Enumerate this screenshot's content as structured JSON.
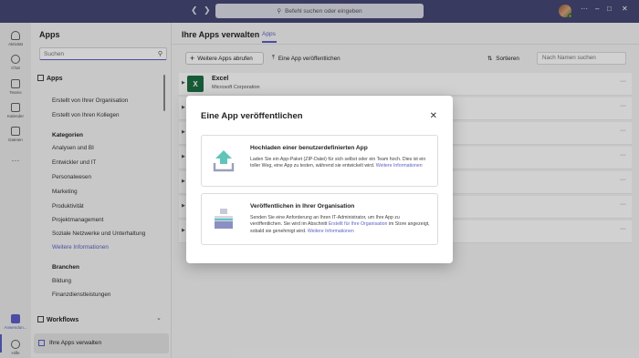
{
  "titlebar": {
    "search_placeholder": "Befehl suchen oder eingeben",
    "back_icon": "chevron-left-icon",
    "forward_icon": "chevron-right-icon"
  },
  "window_controls": {
    "more": "···",
    "minimize": "–",
    "maximize": "□",
    "close": "✕"
  },
  "rail": {
    "items": [
      {
        "label": "Aktivität",
        "icon": "bell-icon"
      },
      {
        "label": "Chat",
        "icon": "chat-icon"
      },
      {
        "label": "Teams",
        "icon": "teams-icon"
      },
      {
        "label": "Kalender",
        "icon": "calendar-icon"
      },
      {
        "label": "Dateien",
        "icon": "file-icon"
      },
      {
        "label": "···",
        "icon": "more-icon"
      },
      {
        "label": "Anwendun...",
        "icon": "apps-icon"
      },
      {
        "label": "Hilfe",
        "icon": "help-icon"
      }
    ]
  },
  "sidebar": {
    "title": "Apps",
    "search_placeholder": "Suchen",
    "section_apps": "Apps",
    "apps_links": [
      "Erstellt von Ihrer Organisation",
      "Erstellt von Ihren Kollegen"
    ],
    "categories_heading": "Kategorien",
    "categories": [
      "Analysen und BI",
      "Entwickler und IT",
      "Personalwesen",
      "Marketing",
      "Produktivität",
      "Projektmanagement",
      "Soziale Netzwerke und Unterhaltung",
      "Weitere Informationen"
    ],
    "branchen_heading": "Branchen",
    "branchen": [
      "Bildung",
      "Finanzdienstleistungen"
    ],
    "workflows": "Workflows",
    "manage_apps": "Ihre Apps verwalten"
  },
  "main": {
    "title": "Ihre Apps verwalten",
    "tab": "Apps",
    "get_more": "Weitere Apps abrufen",
    "publish": "Eine App veröffentlichen",
    "sort": "Sortieren",
    "filter_placeholder": "Nach Namen suchen",
    "rows": [
      {
        "name": "Excel",
        "publisher": "Microsoft Corporation"
      }
    ],
    "row_more": "···"
  },
  "dialog": {
    "title": "Eine App veröffentlichen",
    "close": "✕",
    "cards": [
      {
        "title": "Hochladen einer benutzerdefinierten App",
        "desc": "Laden Sie ein App-Paket (ZIP-Datei) für sich selbst oder ein Team hoch. Dies ist ein toller Weg, eine App zu testen, während sie entwickelt wird.",
        "link": "Weitere Informationen"
      },
      {
        "title": "Veröffentlichen in Ihrer Organisation",
        "desc_pre": "Senden Sie eine Anforderung an Ihren IT-Administrator, um Ihre App zu veröffentlichen. Sie wird im Abschnitt",
        "desc_link": "Erstellt für Ihre Organisation",
        "desc_post": "im Store angezeigt, sobald sie genehmigt wird.",
        "link": "Weitere Informationen"
      }
    ]
  },
  "colors": {
    "titlebar": "#464775",
    "accent": "#5b5fc7",
    "excel": "#1d6f42",
    "upload_teal": "#5fc5b9"
  }
}
